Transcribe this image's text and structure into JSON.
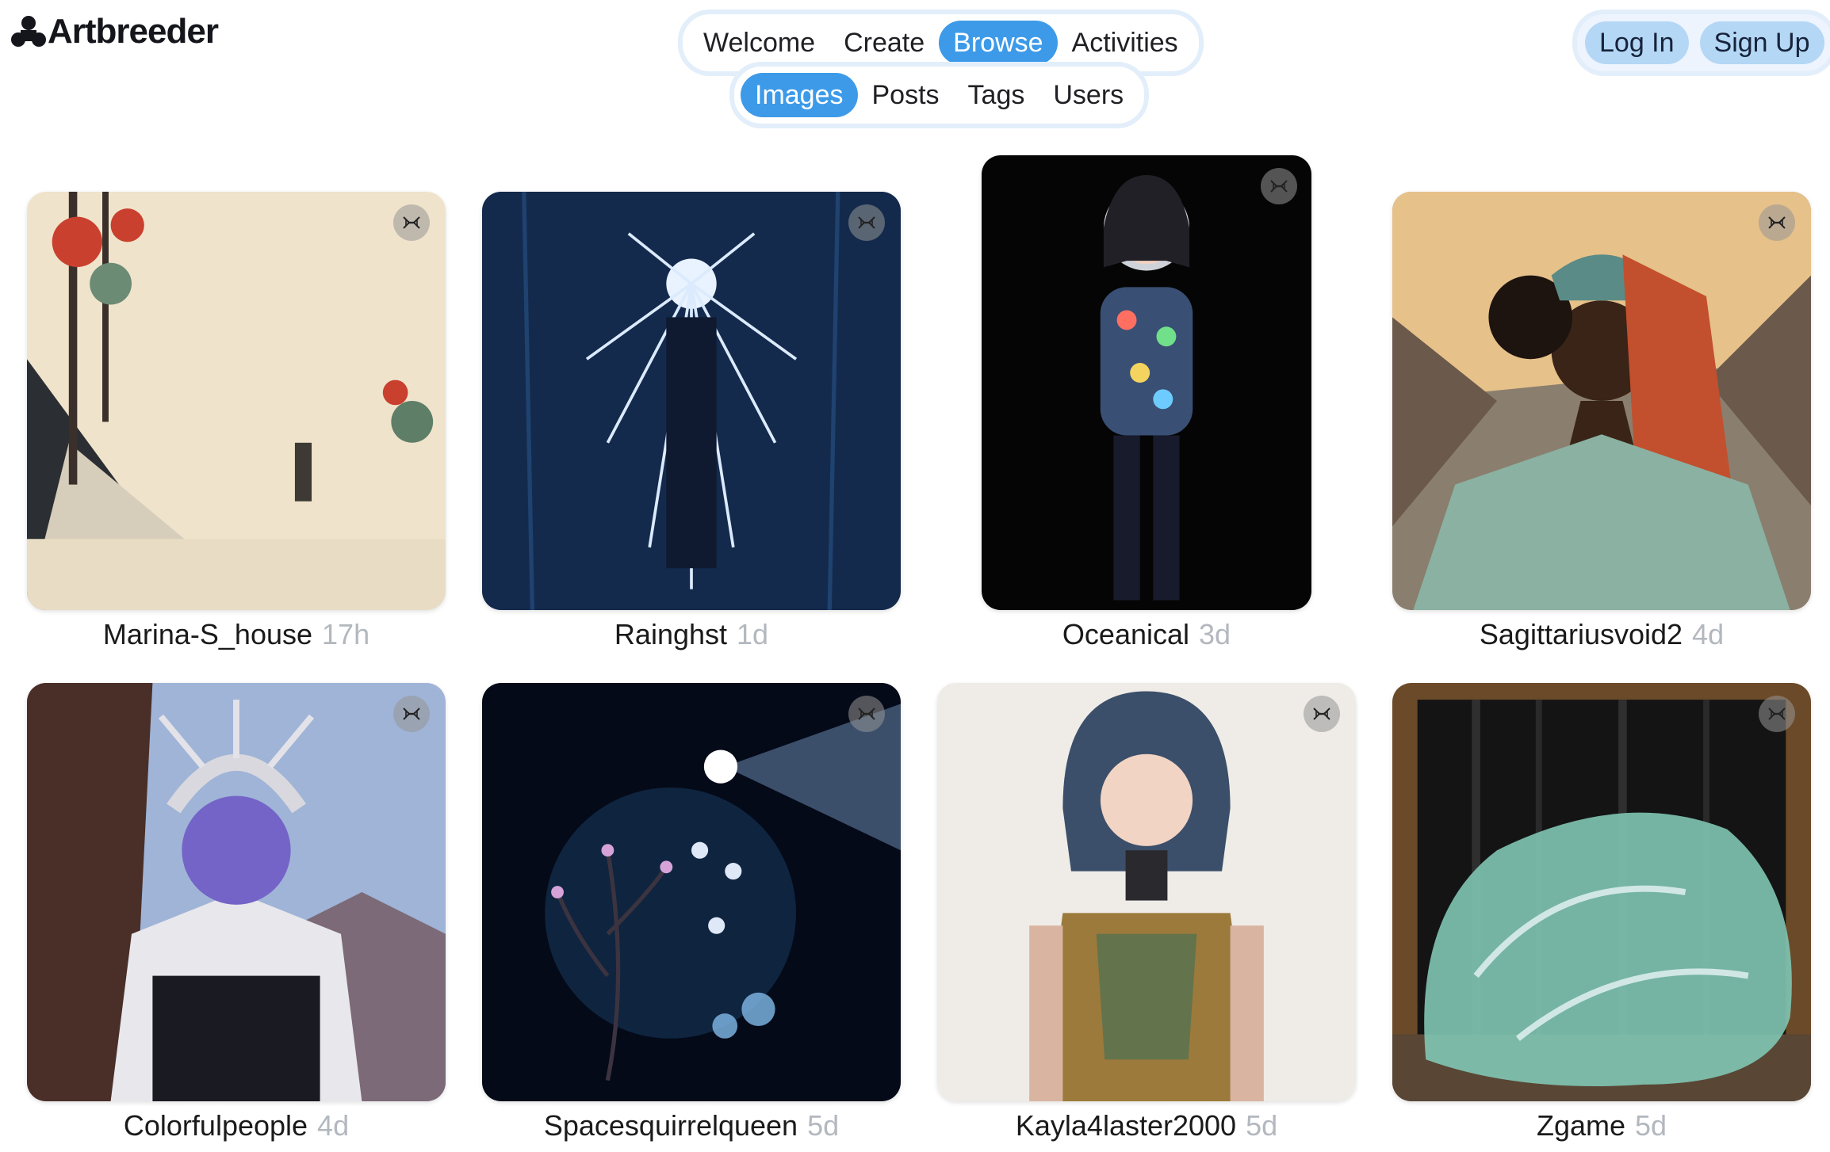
{
  "brand": {
    "name": "Artbreeder"
  },
  "nav": {
    "main": [
      {
        "label": "Welcome",
        "active": false
      },
      {
        "label": "Create",
        "active": false
      },
      {
        "label": "Browse",
        "active": true
      },
      {
        "label": "Activities",
        "active": false
      }
    ],
    "sub": [
      {
        "label": "Images",
        "active": true
      },
      {
        "label": "Posts",
        "active": false
      },
      {
        "label": "Tags",
        "active": false
      },
      {
        "label": "Users",
        "active": false
      }
    ]
  },
  "auth": {
    "login": "Log In",
    "signup": "Sign Up"
  },
  "colors": {
    "accent": "#3c9ae8",
    "auth_button": "#b5d7f6",
    "age_text": "#b3b8bf"
  },
  "gallery": [
    {
      "author": "Marina-S_house",
      "age": "17h",
      "icon": "dna-icon"
    },
    {
      "author": "Rainghst",
      "age": "1d",
      "icon": "dna-icon"
    },
    {
      "author": "Oceanical",
      "age": "3d",
      "icon": "dna-icon"
    },
    {
      "author": "Sagittariusvoid2",
      "age": "4d",
      "icon": "dna-icon"
    },
    {
      "author": "Colorfulpeople",
      "age": "4d",
      "icon": "dna-icon"
    },
    {
      "author": "Spacesquirrelqueen",
      "age": "5d",
      "icon": "dna-icon"
    },
    {
      "author": "Kayla4laster2000",
      "age": "5d",
      "icon": "dna-icon"
    },
    {
      "author": "Zgame",
      "age": "5d",
      "icon": "dna-icon"
    }
  ]
}
